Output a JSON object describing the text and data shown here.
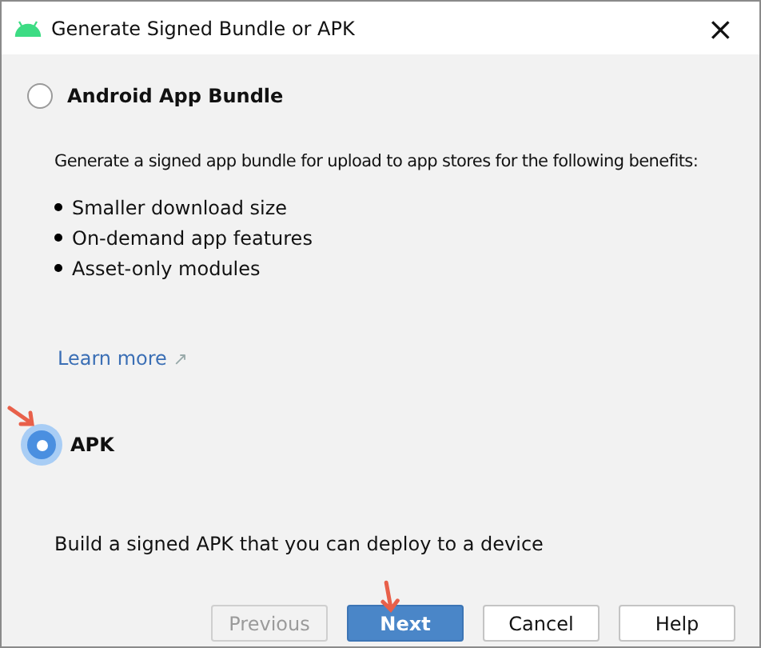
{
  "window": {
    "title": "Generate Signed Bundle or APK",
    "close": "×"
  },
  "options": [
    {
      "label": "Android App Bundle",
      "selected": false,
      "description": "Generate a signed app bundle for upload to app stores for the following benefits:",
      "bullets": [
        "Smaller download size",
        "On-demand app features",
        "Asset-only modules"
      ],
      "link": "Learn more",
      "link_icon": "↗"
    },
    {
      "label": "APK",
      "selected": true,
      "description": "Build a signed APK that you can deploy to a device"
    }
  ],
  "buttons": [
    {
      "label": "Previous",
      "kind": "normal",
      "disabled": true
    },
    {
      "label": "Next",
      "kind": "primary",
      "disabled": false
    },
    {
      "label": "Cancel",
      "kind": "normal",
      "disabled": false
    },
    {
      "label": "Help",
      "kind": "normal",
      "disabled": false
    }
  ]
}
